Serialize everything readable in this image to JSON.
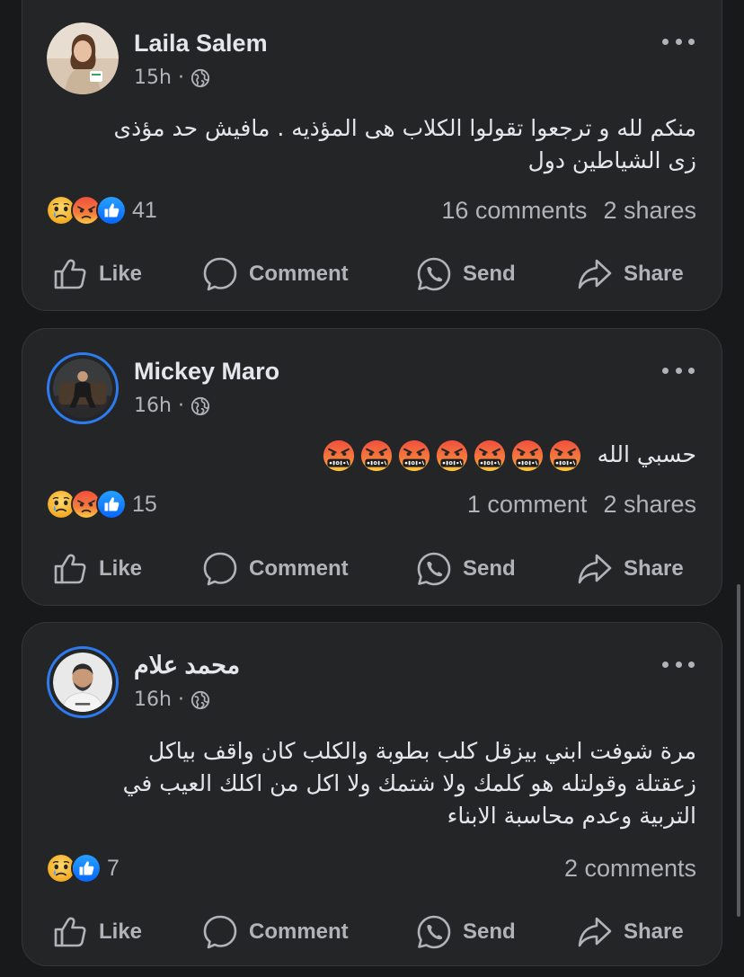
{
  "posts": [
    {
      "author": "Laila Salem",
      "time": "15h",
      "lines": [
        "منكم لله و ترجعوا تقولوا الكلاب هى المؤذيه . مافيش حد مؤذى",
        "زى  الشياطين دول"
      ],
      "reaction_icons": [
        "sad-reaction",
        "angry-reaction",
        "like-reaction"
      ],
      "reaction_count": "41",
      "comments": "16 comments",
      "shares": "2 shares"
    },
    {
      "author": "Mickey Maro",
      "time": "16h",
      "lines": [
        "حسبي الله"
      ],
      "emoji_trail": [
        "angry-emoji",
        "angry-emoji",
        "angry-emoji",
        "angry-emoji",
        "angry-emoji",
        "angry-emoji",
        "angry-emoji"
      ],
      "reaction_icons": [
        "sad-reaction",
        "angry-reaction",
        "like-reaction"
      ],
      "reaction_count": "15",
      "comments": "1 comment",
      "shares": "2 shares"
    },
    {
      "author": "محمد علام",
      "time": "16h",
      "lines": [
        "مرة شوفت ابني بيزقل كلب بطوبة والكلب كان واقف بياكل",
        "زعقتلة وقولتله هو كلمك ولا شتمك ولا اكل من اكلك  العيب في",
        "التربية وعدم محاسبة الابناء"
      ],
      "reaction_icons": [
        "sad-reaction",
        "like-reaction"
      ],
      "reaction_count": "7",
      "comments": "2 comments",
      "shares": ""
    }
  ],
  "actions": {
    "like": "Like",
    "comment": "Comment",
    "send": "Send",
    "share": "Share"
  },
  "icons": {
    "meta_separator": "·",
    "privacy": "globe-icon",
    "more": "more-options-icon"
  },
  "colors": {
    "background": "#18191b",
    "card": "#242527",
    "text": "#e4e6eb",
    "muted": "#b0b3b8",
    "accent_ring": "#2d7bf0",
    "like_blue": "#1b74e4",
    "angry_red": "#e9513d",
    "sad_yellow": "#f7b125"
  }
}
